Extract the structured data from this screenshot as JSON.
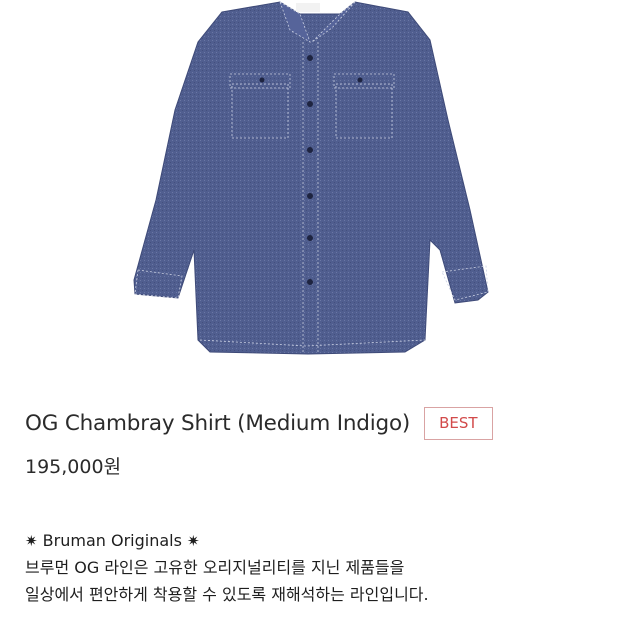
{
  "product": {
    "image_alt": "OG Chambray Shirt (Medium Indigo)",
    "brand_label": "Bruman",
    "title": "OG Chambray Shirt (Medium Indigo)",
    "badge": "BEST",
    "price": "195,000원"
  },
  "description": {
    "line1_star_left": "✷",
    "line1_text": "Bruman Originals",
    "line1_star_right": "✷",
    "line2": "브루먼 OG 라인은 고유한 오리지널리티를 지닌 제품들을",
    "line3": "일상에서 편안하게 착용할 수 있도록 재해석하는 라인입니다."
  },
  "colors": {
    "shirt": "#4f5d8e",
    "stitch": "#c9cfe2",
    "badge_text": "#d24a4a",
    "badge_border": "#d9a3a3"
  },
  "icons": [
    "eight-point-star-icon"
  ]
}
